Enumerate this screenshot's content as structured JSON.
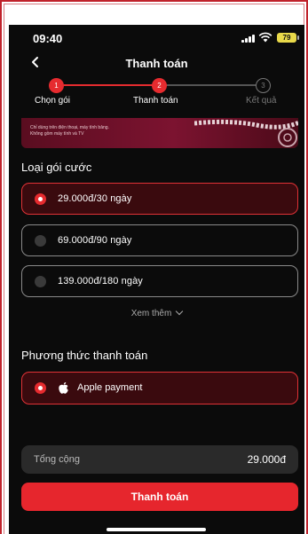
{
  "status_bar": {
    "time": "09:40",
    "battery": "79"
  },
  "nav": {
    "title": "Thanh toán"
  },
  "stepper": {
    "steps": [
      {
        "number": "1",
        "label": "Chọn gói"
      },
      {
        "number": "2",
        "label": "Thanh toán"
      },
      {
        "number": "3",
        "label": "Kết quả"
      }
    ]
  },
  "banner": {
    "line1": "Chỉ dùng trên điện thoại, máy tính bảng.",
    "line2": "Không gồm máy tính và TV"
  },
  "plans": {
    "title": "Loại gói cước",
    "options": [
      {
        "label": "29.000đ/30 ngày",
        "selected": true
      },
      {
        "label": "69.000đ/90 ngày",
        "selected": false
      },
      {
        "label": "139.000đ/180 ngày",
        "selected": false
      }
    ],
    "more_label": "Xem thêm"
  },
  "payment": {
    "title": "Phương thức thanh toán",
    "method_label": "Apple payment"
  },
  "total": {
    "label": "Tổng cộng",
    "value": "29.000đ"
  },
  "pay_button": "Thanh toán",
  "colors": {
    "accent": "#e62b2f",
    "selected_bg": "#3a0a0e",
    "background": "#0b0b0b"
  }
}
